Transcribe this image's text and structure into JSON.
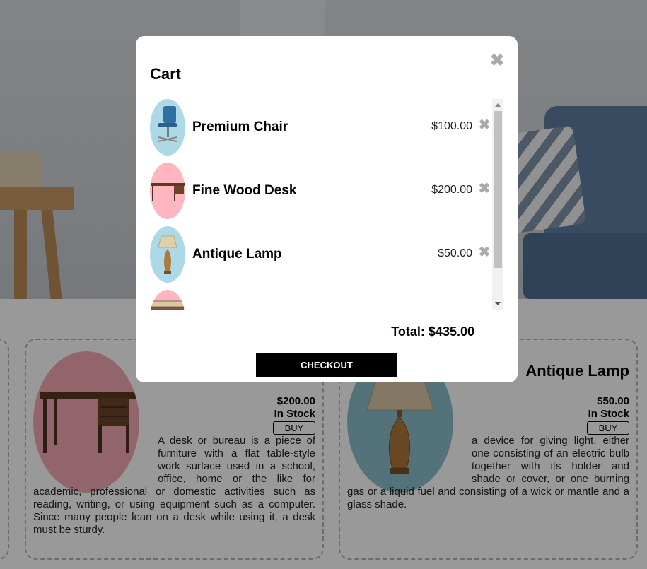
{
  "page": {
    "products": [
      {
        "name": "",
        "price": "$200.00",
        "stock": "In Stock",
        "buy_label": "BUY",
        "description": "A desk or bureau is a piece of furniture with a flat table-style work surface used in a school, office, home or the like for academic, professional or domestic activities such as reading, writing, or using equipment such as a computer. Since many people lean on a desk while using it, a desk must be sturdy.",
        "image_icon": "desk-image"
      },
      {
        "name": "Antique Lamp",
        "price": "$50.00",
        "stock": "In Stock",
        "buy_label": "BUY",
        "description": "a device for giving light, either one consisting of an electric bulb together with its holder and shade or cover, or one burning gas or a liquid fuel and consisting of a wick or mantle and a glass shade.",
        "image_icon": "lamp-image"
      }
    ]
  },
  "cart": {
    "title": "Cart",
    "close_icon": "close-icon",
    "items": [
      {
        "name": "Premium Chair",
        "price": "$100.00",
        "bg": "#add8e6",
        "icon": "chair-image"
      },
      {
        "name": "Fine Wood Desk",
        "price": "$200.00",
        "bg": "#ffb6c1",
        "icon": "desk-image"
      },
      {
        "name": "Antique Lamp",
        "price": "$50.00",
        "bg": "#add8e6",
        "icon": "lamp-image"
      },
      {
        "name": "",
        "price": "",
        "bg": "#ffb6c1",
        "icon": "table-image"
      }
    ],
    "total": "Total: $435.00",
    "checkout_label": "CHECKOUT"
  },
  "colors": {
    "overlay": "rgba(0,0,0,0.40)",
    "checkout_bg": "#000000",
    "remove_icon": "#aaaaaa"
  }
}
